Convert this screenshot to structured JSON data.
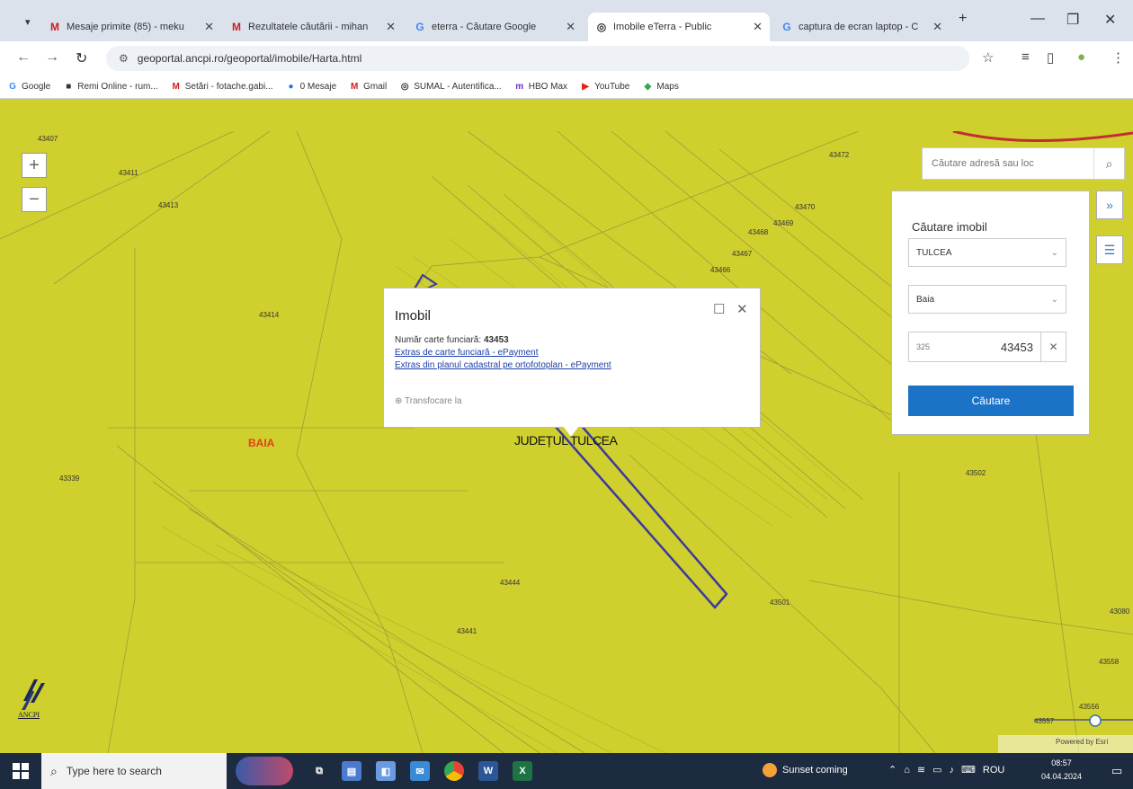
{
  "browser": {
    "tabs": [
      {
        "title": "Mesaje primite (85) - meku",
        "favicon": "M",
        "color": "#c5221f"
      },
      {
        "title": "Rezultatele căutării - mihan",
        "favicon": "M",
        "color": "#c5221f"
      },
      {
        "title": "eterra - Căutare Google",
        "favicon": "G",
        "color": "#4285f4"
      },
      {
        "title": "Imobile eTerra - Public",
        "favicon": "◎",
        "color": "#333333"
      },
      {
        "title": "captura de ecran laptop - C",
        "favicon": "G",
        "color": "#4285f4"
      }
    ],
    "url": "geoportal.ancpi.ro/geoportal/imobile/Harta.html",
    "bookmarks": [
      {
        "label": "Google",
        "icon": "G",
        "color": "#4285f4"
      },
      {
        "label": "Remi Online - rum...",
        "icon": "■",
        "color": "#333333"
      },
      {
        "label": "Setări - fotache.gabi...",
        "icon": "M",
        "color": "#c5221f"
      },
      {
        "label": "0 Mesaje",
        "icon": "●",
        "color": "#1a73e8"
      },
      {
        "label": "Gmail",
        "icon": "M",
        "color": "#c5221f"
      },
      {
        "label": "SUMAL - Autentifica...",
        "icon": "◎",
        "color": "#333333"
      },
      {
        "label": "HBO Max",
        "icon": "m",
        "color": "#6c2bd9"
      },
      {
        "label": "YouTube",
        "icon": "▶",
        "color": "#e62117"
      },
      {
        "label": "Maps",
        "icon": "◆",
        "color": "#34a853"
      }
    ]
  },
  "map": {
    "parcel_labels": [
      "43407",
      "43411",
      "43413",
      "43414",
      "43472",
      "43470",
      "43469",
      "43468",
      "43467",
      "43466",
      "43339",
      "43444",
      "43441",
      "43501",
      "43502",
      "43080",
      "43558",
      "43556",
      "43557"
    ],
    "place_label": "BAIA",
    "county_label": "JUDEȚUL TULCEA",
    "address_search_placeholder": "Căutare adresă sau loc",
    "search_panel": {
      "title": "Căutare imobil",
      "county": "TULCEA",
      "locality": "Baia",
      "number_prefix": "325",
      "number_value": "43453",
      "button_label": "Căutare"
    },
    "popup": {
      "title": "Imobil",
      "cf_label": "Număr carte funciară:",
      "cf_value": "43453",
      "link1": "Extras de carte funciară - ePayment",
      "link2": "Extras din planul cadastral pe ortofotoplan - ePayment",
      "transform_label": "Transfocare la"
    },
    "logo_text": "ANCPI",
    "attribution": "Powered by Esri"
  },
  "taskbar": {
    "search_placeholder": "Type here to search",
    "weather": "Sunset coming",
    "language": "ROU",
    "time": "08:57",
    "date": "04.04.2024"
  }
}
